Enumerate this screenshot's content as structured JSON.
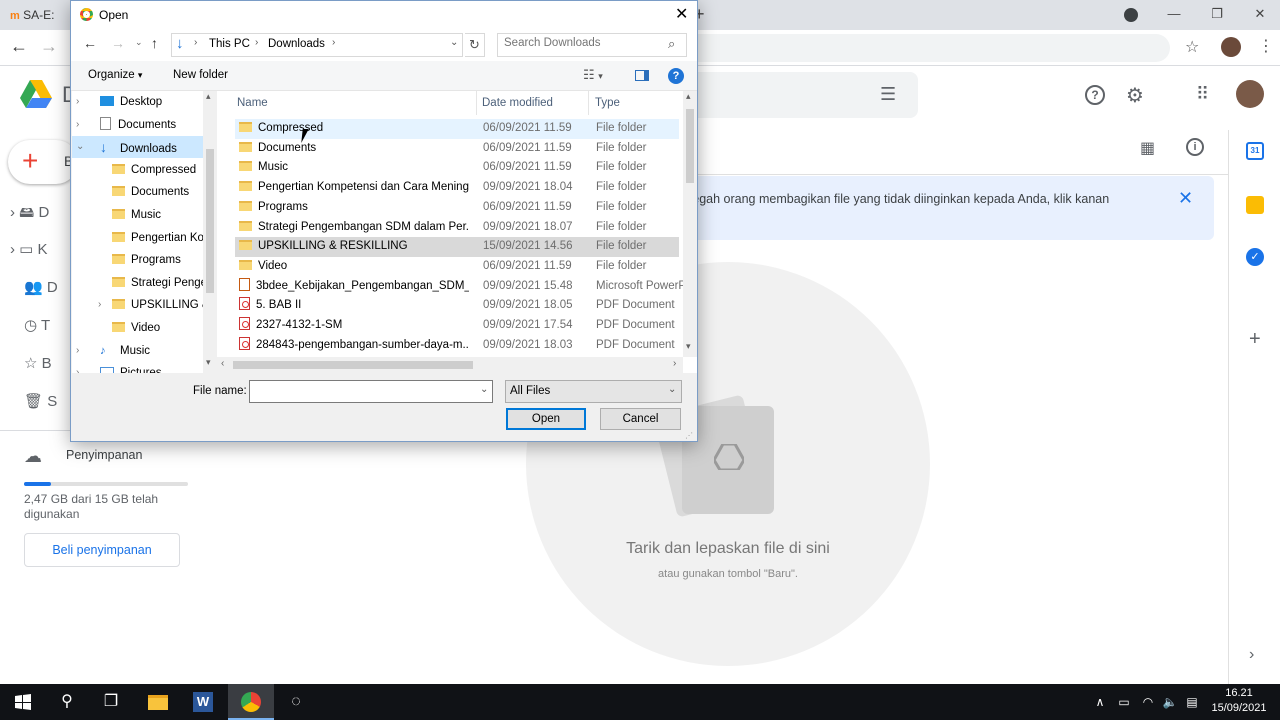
{
  "browser": {
    "tab_title": "SA-E:",
    "new_tab": "+",
    "window_controls": [
      "—",
      "❐",
      "✕"
    ],
    "nav": {
      "back": "←",
      "forward": "→"
    }
  },
  "drive": {
    "logo_letter": "D",
    "new_label": "B",
    "sidebar_letters": [
      "D",
      "K",
      "D",
      "T",
      "B",
      "S"
    ],
    "storage_label": "Penyimpanan",
    "storage_usage": "2,47 GB dari 15 GB telah digunakan",
    "storage_fraction": 0.165,
    "buy_storage": "Beli penyimpanan",
    "banner_text": "cegah orang membagikan file yang tidak diinginkan kepada Anda, klik kanan",
    "drop_title": "Tarik dan lepaskan file di sini",
    "drop_sub": "atau gunakan tombol \"Baru\".",
    "calendar_day": "31"
  },
  "dialog": {
    "title": "Open",
    "breadcrumb": [
      "This PC",
      "Downloads"
    ],
    "search_placeholder": "Search Downloads",
    "organize": "Organize",
    "new_folder": "New folder",
    "nav_items": [
      {
        "label": "Desktop",
        "kind": "desktop",
        "indent": 0,
        "expand": "›"
      },
      {
        "label": "Documents",
        "kind": "docs",
        "indent": 0,
        "expand": "›"
      },
      {
        "label": "Downloads",
        "kind": "download",
        "indent": 0,
        "expand": "⌄",
        "selected": true
      },
      {
        "label": "Compressed",
        "kind": "folder",
        "indent": 1
      },
      {
        "label": "Documents",
        "kind": "folder",
        "indent": 1
      },
      {
        "label": "Music",
        "kind": "folder",
        "indent": 1
      },
      {
        "label": "Pengertian Kor",
        "kind": "folder",
        "indent": 1
      },
      {
        "label": "Programs",
        "kind": "folder",
        "indent": 1
      },
      {
        "label": "Strategi Penge",
        "kind": "folder",
        "indent": 1
      },
      {
        "label": "UPSKILLING &",
        "kind": "folder",
        "indent": 1,
        "expand": "›"
      },
      {
        "label": "Video",
        "kind": "folder",
        "indent": 1
      },
      {
        "label": "Music",
        "kind": "music",
        "indent": 0,
        "expand": "›"
      },
      {
        "label": "Pictures",
        "kind": "pictures",
        "indent": 0,
        "expand": "›"
      }
    ],
    "columns": {
      "name": "Name",
      "date": "Date modified",
      "type": "Type"
    },
    "files": [
      {
        "name": "Compressed",
        "date": "06/09/2021 11.59",
        "type": "File folder",
        "icon": "folder",
        "state": "hover"
      },
      {
        "name": "Documents",
        "date": "06/09/2021 11.59",
        "type": "File folder",
        "icon": "folder"
      },
      {
        "name": "Music",
        "date": "06/09/2021 11.59",
        "type": "File folder",
        "icon": "folder"
      },
      {
        "name": "Pengertian Kompetensi dan Cara Mening...",
        "date": "09/09/2021 18.04",
        "type": "File folder",
        "icon": "folder"
      },
      {
        "name": "Programs",
        "date": "06/09/2021 11.59",
        "type": "File folder",
        "icon": "folder"
      },
      {
        "name": "Strategi Pengembangan SDM dalam Per...",
        "date": "09/09/2021 18.07",
        "type": "File folder",
        "icon": "folder"
      },
      {
        "name": "UPSKILLING & RESKILLING",
        "date": "15/09/2021 14.56",
        "type": "File folder",
        "icon": "folder",
        "state": "selected"
      },
      {
        "name": "Video",
        "date": "06/09/2021 11.59",
        "type": "File folder",
        "icon": "folder"
      },
      {
        "name": "3bdee_Kebijakan_Pengembangan_SDM__...",
        "date": "09/09/2021 15.48",
        "type": "Microsoft PowerP",
        "icon": "ppt"
      },
      {
        "name": "5. BAB II",
        "date": "09/09/2021 18.05",
        "type": "PDF Document",
        "icon": "pdf"
      },
      {
        "name": "2327-4132-1-SM",
        "date": "09/09/2021 17.54",
        "type": "PDF Document",
        "icon": "pdf"
      },
      {
        "name": "284843-pengembangan-sumber-daya-m...",
        "date": "09/09/2021 18.03",
        "type": "PDF Document",
        "icon": "pdf"
      }
    ],
    "file_name_label": "File name:",
    "file_name_value": "",
    "filter": "All Files",
    "open_button": "Open",
    "cancel_button": "Cancel"
  },
  "taskbar": {
    "time": "16.21",
    "date": "15/09/2021"
  },
  "colors": {
    "drive_blue": "#1a73e8",
    "selection": "#cce8ff",
    "taskbar": "#101216"
  }
}
